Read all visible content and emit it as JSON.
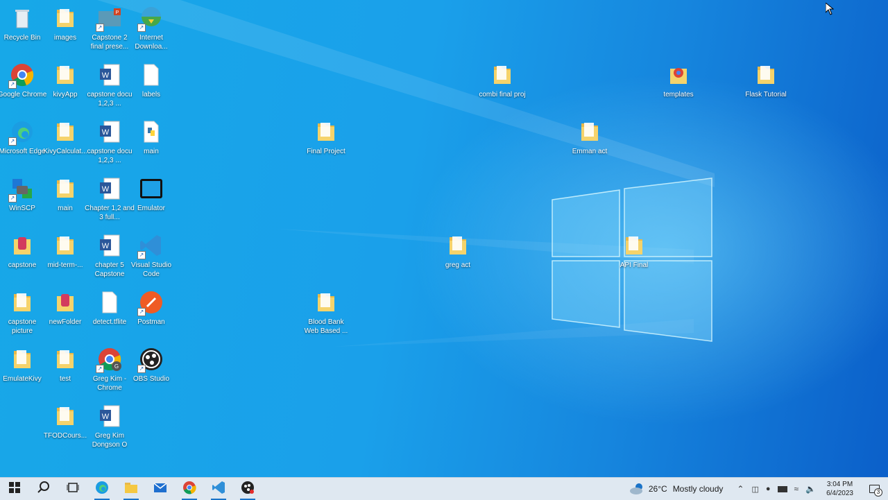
{
  "desktop": {
    "icons": [
      {
        "name": "recycle-bin-icon",
        "label": "Recycle Bin",
        "type": "bin"
      },
      {
        "name": "images-folder-icon",
        "label": "images",
        "type": "folder"
      },
      {
        "name": "powerpoint-file-icon",
        "label": "Capstone 2 final prese...",
        "type": "ppt"
      },
      {
        "name": "internet-download-manager-icon",
        "label": "Internet Downloa...",
        "type": "idm"
      },
      {
        "name": "google-chrome-icon",
        "label": "Google Chrome",
        "type": "chrome"
      },
      {
        "name": "folder-icon",
        "label": "kivyApp",
        "type": "folder"
      },
      {
        "name": "word-document-icon",
        "label": "capstone docu 1,2,3 ...",
        "type": "word"
      },
      {
        "name": "blank-file-icon",
        "label": "labels",
        "type": "file"
      },
      {
        "name": "microsoft-edge-icon",
        "label": "Microsoft Edge",
        "type": "edge"
      },
      {
        "name": "folder-icon",
        "label": "KivyCalculat...",
        "type": "folder"
      },
      {
        "name": "word-document-icon",
        "label": "capstone docu 1,2,3 ...",
        "type": "word"
      },
      {
        "name": "python-file-icon",
        "label": "main",
        "type": "python"
      },
      {
        "name": "winscp-icon",
        "label": "WinSCP",
        "type": "winscp"
      },
      {
        "name": "folder-icon",
        "label": "main",
        "type": "folder"
      },
      {
        "name": "word-document-icon",
        "label": "Chapter 1,2 and 3 full...",
        "type": "word"
      },
      {
        "name": "emulator-icon",
        "label": "Emulator",
        "type": "emulator"
      },
      {
        "name": "database-folder-icon",
        "label": "capstone",
        "type": "folder-db"
      },
      {
        "name": "folder-icon",
        "label": "mid-term-...",
        "type": "folder"
      },
      {
        "name": "word-document-icon",
        "label": "chapter 5 Capstone",
        "type": "word"
      },
      {
        "name": "visual-studio-code-icon",
        "label": "Visual Studio Code",
        "type": "vscode"
      },
      {
        "name": "folder-icon",
        "label": "capstone picture",
        "type": "folder"
      },
      {
        "name": "database-folder-icon",
        "label": "newFolder",
        "type": "folder-db"
      },
      {
        "name": "blank-file-icon",
        "label": "detect.tflite",
        "type": "file"
      },
      {
        "name": "postman-icon",
        "label": "Postman",
        "type": "postman"
      },
      {
        "name": "folder-icon",
        "label": "EmulateKivy",
        "type": "folder"
      },
      {
        "name": "folder-icon",
        "label": "test",
        "type": "folder"
      },
      {
        "name": "chrome-profile-icon",
        "label": "Greg Kim - Chrome",
        "type": "chrome-profile"
      },
      {
        "name": "obs-studio-icon",
        "label": "OBS Studio",
        "type": "obs"
      },
      {
        "name": "folder-icon",
        "label": "TFODCours...",
        "type": "folder"
      },
      {
        "name": "word-document-icon",
        "label": "Greg Kim Dongson O",
        "type": "word"
      },
      {
        "name": "folder-icon",
        "label": "combi final proj",
        "type": "folder"
      },
      {
        "name": "chrome-folder-icon",
        "label": "templates",
        "type": "folder-chrome"
      },
      {
        "name": "folder-icon",
        "label": "Flask Tutorial",
        "type": "folder"
      },
      {
        "name": "folder-icon",
        "label": "Final Project",
        "type": "folder"
      },
      {
        "name": "folder-icon",
        "label": "Emman act",
        "type": "folder"
      },
      {
        "name": "folder-icon",
        "label": "greg act",
        "type": "folder"
      },
      {
        "name": "folder-icon",
        "label": "API Final",
        "type": "folder"
      },
      {
        "name": "folder-icon",
        "label": "Blood Bank Web Based ...",
        "type": "folder"
      }
    ]
  },
  "taskbar": {
    "apps": [
      {
        "name": "start-button",
        "icon": "windows-logo-icon"
      },
      {
        "name": "search-button",
        "icon": "search-icon"
      },
      {
        "name": "task-view-button",
        "icon": "task-view-icon"
      },
      {
        "name": "taskbar-edge",
        "icon": "edge-icon"
      },
      {
        "name": "taskbar-file-explorer",
        "icon": "folder-icon"
      },
      {
        "name": "taskbar-mail",
        "icon": "mail-icon"
      },
      {
        "name": "taskbar-chrome",
        "icon": "chrome-icon"
      },
      {
        "name": "taskbar-vscode",
        "icon": "vscode-icon"
      },
      {
        "name": "taskbar-obs",
        "icon": "obs-icon"
      }
    ],
    "weather": {
      "temp": "26°C",
      "condition": "Mostly cloudy",
      "badge": "1"
    },
    "clock": {
      "time": "3:04 PM",
      "date": "6/4/2023"
    },
    "notifications": {
      "count": "3"
    }
  },
  "colors": {
    "accent": "#1a73c8",
    "folder": "#f5d36b",
    "word": "#2b579a"
  }
}
